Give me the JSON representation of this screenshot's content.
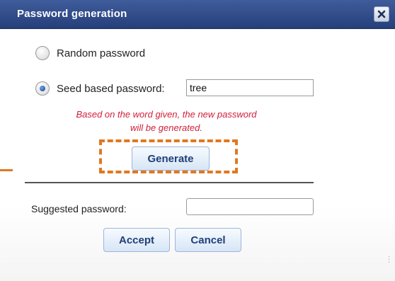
{
  "dialog": {
    "title": "Password generation",
    "close_icon": "close-icon"
  },
  "options": {
    "random_label": "Random password",
    "seed_label": "Seed based password:",
    "selected": "seed"
  },
  "seed_input": {
    "value": "tree"
  },
  "hint": {
    "line1": "Based on the word given, the new password",
    "line2": "will be generated."
  },
  "buttons": {
    "generate": "Generate",
    "accept": "Accept",
    "cancel": "Cancel"
  },
  "suggested": {
    "label": "Suggested password:",
    "value": ""
  },
  "colors": {
    "titlebar": "#2f4a8a",
    "hint_text": "#d0203a",
    "highlight": "#e07820",
    "button_text": "#1f3f78"
  }
}
